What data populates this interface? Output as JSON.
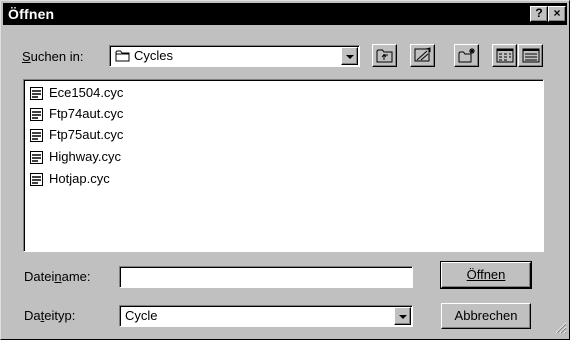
{
  "window": {
    "title": "Öffnen",
    "help_label": "?",
    "close_label": "×"
  },
  "look_in": {
    "label": "Suchen in:",
    "value": "Cycles",
    "folder_icon": "folder-icon"
  },
  "toolbar": {
    "icons": [
      "up-one-level-icon",
      "desktop-icon",
      "new-folder-icon",
      "list-view-icon",
      "details-view-icon"
    ]
  },
  "files": [
    {
      "name": "Ece1504.cyc",
      "icon": "cyc-file-icon"
    },
    {
      "name": "Ftp74aut.cyc",
      "icon": "cyc-file-icon"
    },
    {
      "name": "Ftp75aut.cyc",
      "icon": "cyc-file-icon"
    },
    {
      "name": "Highway.cyc",
      "icon": "cyc-file-icon"
    },
    {
      "name": "Hotjap.cyc",
      "icon": "cyc-file-icon"
    }
  ],
  "filename": {
    "label": "Dateiname:",
    "value": "",
    "placeholder": ""
  },
  "filetype": {
    "label": "Dateityp:",
    "value": "Cycle"
  },
  "buttons": {
    "open_label": "Öffnen",
    "cancel_label": "Abbrechen"
  }
}
